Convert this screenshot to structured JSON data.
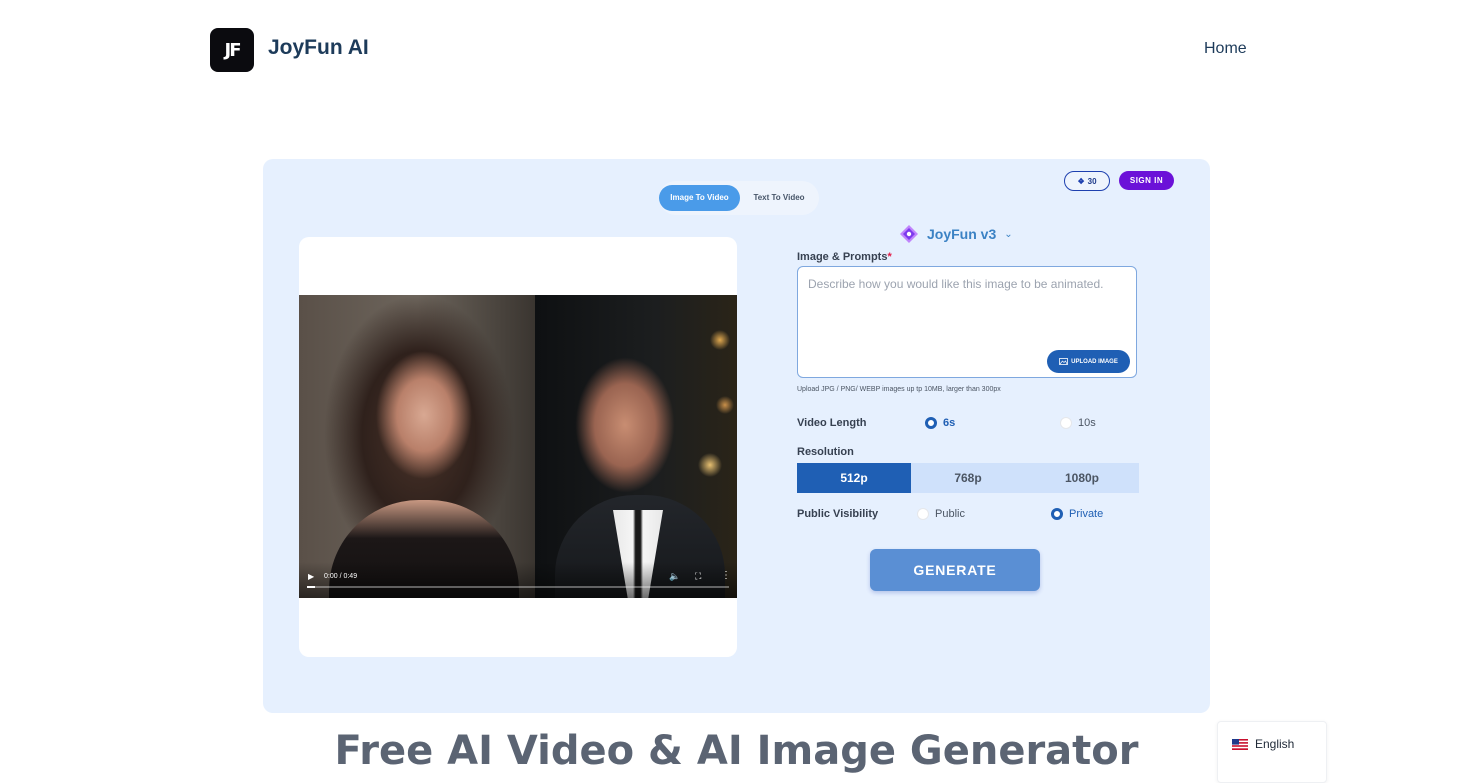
{
  "header": {
    "logo_text": "JF",
    "brand": "JoyFun AI",
    "nav_home": "Home"
  },
  "tabs": {
    "image_to_video": "Image To Video",
    "text_to_video": "Text To Video"
  },
  "account": {
    "credits": "30",
    "sign_in": "SIGN IN"
  },
  "video": {
    "time": "0:00 / 0:49",
    "progress": 0.02
  },
  "model": {
    "name": "JoyFun v3"
  },
  "form": {
    "prompt_label": "Image & Prompts",
    "required_mark": "*",
    "prompt_placeholder": "Describe how you would like this image to be animated.",
    "prompt_value": "",
    "upload_label": "UPLOAD IMAGE",
    "upload_hint": "Upload JPG / PNG/ WEBP images up tp 10MB, larger than 300px",
    "video_length_label": "Video Length",
    "length_6s": "6s",
    "length_10s": "10s",
    "resolution_label": "Resolution",
    "res_512": "512p",
    "res_768": "768p",
    "res_1080": "1080p",
    "visibility_label": "Public Visibility",
    "vis_public": "Public",
    "vis_private": "Private",
    "generate": "GENERATE"
  },
  "hero": {
    "title": "Free AI Video & AI Image Generator"
  },
  "language": {
    "label": "English"
  },
  "colors": {
    "accent": "#1f5fb4",
    "signin": "#6b11d8",
    "card_bg": "#e6f0fe"
  }
}
